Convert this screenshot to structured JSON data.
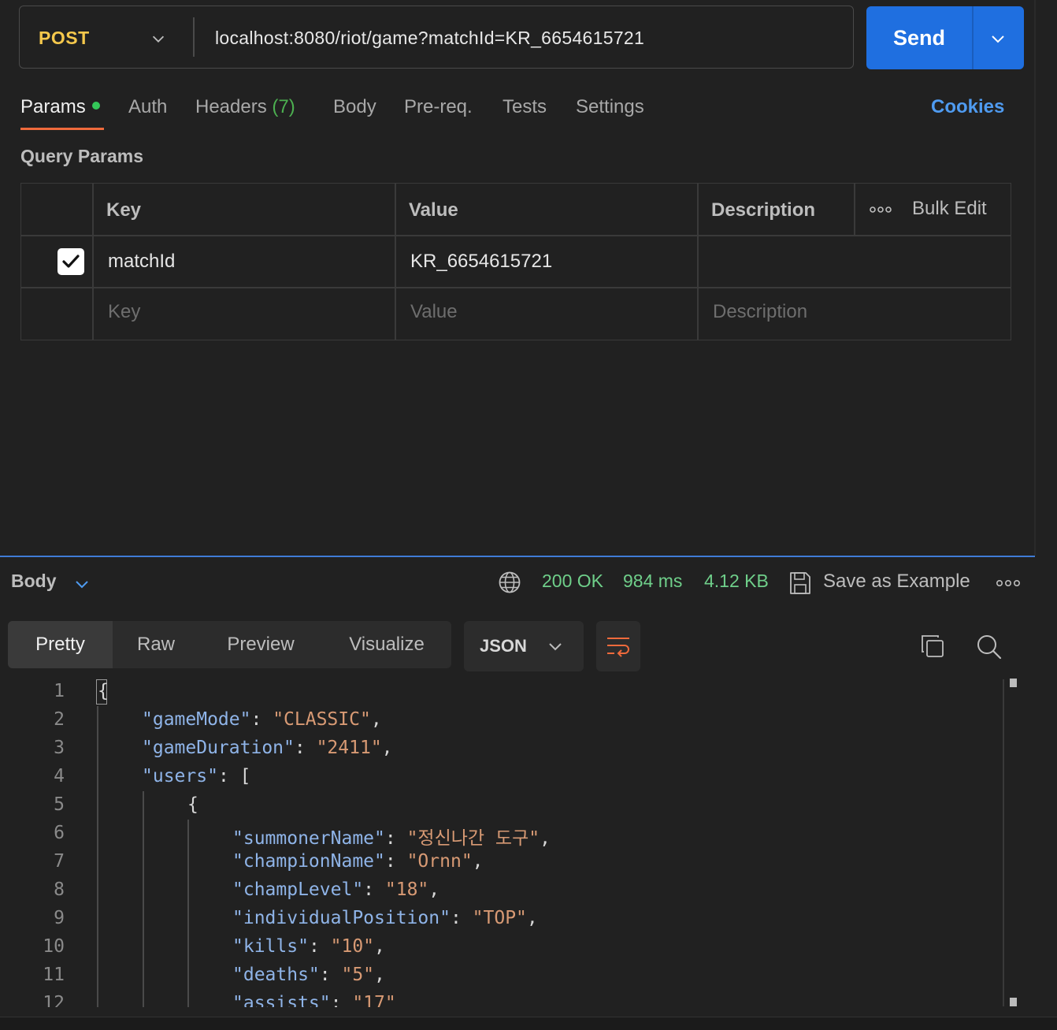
{
  "request": {
    "method": "POST",
    "url": "localhost:8080/riot/game?matchId=KR_6654615721",
    "send_label": "Send"
  },
  "tabs": {
    "params": "Params",
    "auth": "Auth",
    "headers": "Headers",
    "headers_count": "(7)",
    "body": "Body",
    "prereq": "Pre-req.",
    "tests": "Tests",
    "settings": "Settings",
    "cookies": "Cookies"
  },
  "query_params": {
    "title": "Query Params",
    "headers": {
      "key": "Key",
      "value": "Value",
      "description": "Description",
      "bulk_edit": "Bulk Edit"
    },
    "rows": [
      {
        "checked": true,
        "key": "matchId",
        "value": "KR_6654615721",
        "description": ""
      }
    ],
    "placeholders": {
      "key": "Key",
      "value": "Value",
      "description": "Description"
    }
  },
  "response": {
    "section_label": "Body",
    "status": "200 OK",
    "time": "984 ms",
    "size": "4.12 KB",
    "save_example": "Save as Example",
    "view_tabs": [
      "Pretty",
      "Raw",
      "Preview",
      "Visualize"
    ],
    "format": "JSON",
    "line_numbers": [
      "1",
      "2",
      "3",
      "4",
      "5",
      "6",
      "7",
      "8",
      "9",
      "10",
      "11",
      "12"
    ],
    "code": [
      {
        "open": "{"
      },
      {
        "key": "\"gameMode\"",
        "value": "\"CLASSIC\""
      },
      {
        "key": "\"gameDuration\"",
        "value": "\"2411\""
      },
      {
        "key": "\"users\"",
        "value": "["
      },
      {
        "open": "{"
      },
      {
        "key": "\"summonerName\"",
        "value": "\"정신나간 도구\""
      },
      {
        "key": "\"championName\"",
        "value": "\"Ornn\""
      },
      {
        "key": "\"champLevel\"",
        "value": "\"18\""
      },
      {
        "key": "\"individualPosition\"",
        "value": "\"TOP\""
      },
      {
        "key": "\"kills\"",
        "value": "\"10\""
      },
      {
        "key": "\"deaths\"",
        "value": "\"5\""
      },
      {
        "key": "\"assists\"",
        "value": "\"17\""
      }
    ]
  },
  "colors": {
    "method": "#f5c84c",
    "send": "#1f6fe0",
    "accent_tab": "#ef6a3c",
    "status": "#6fcf8a",
    "json_key": "#8fb4e8",
    "json_string": "#d89a74"
  },
  "icons": [
    "chevron-down-icon",
    "globe-icon",
    "save-icon",
    "more-icon",
    "wrap-lines-icon",
    "copy-icon",
    "search-icon",
    "checkmark-icon"
  ]
}
